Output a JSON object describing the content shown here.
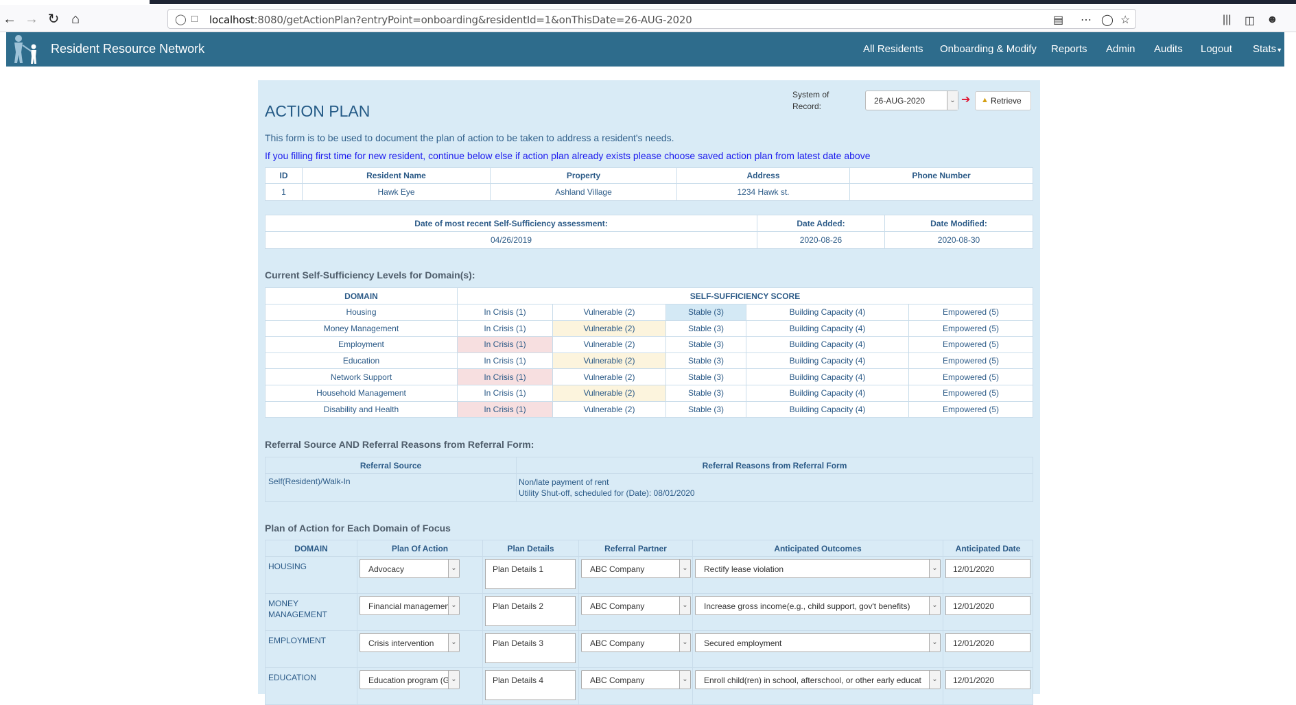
{
  "browser": {
    "url_host": "localhost",
    "url_rest": ":8080/getActionPlan?entryPoint=onboarding&residentId=1&onThisDate=26-AUG-2020"
  },
  "app": {
    "brand": "Resident Resource Network",
    "menu": [
      "All Residents",
      "Onboarding & Modify",
      "Reports",
      "Admin",
      "Audits",
      "Logout",
      "Stats"
    ]
  },
  "header": {
    "title": "ACTION PLAN",
    "system_of_record": "System of Record:",
    "date_value": "26-AUG-2020",
    "retrieve_label": "Retrieve",
    "desc1": "This form is to be used to document the plan of action to be taken to address a resident's needs.",
    "desc2": "If you filling first time for new resident, continue below else if action plan already exists please choose saved action plan from latest date above"
  },
  "resident": {
    "headers": [
      "ID",
      "Resident Name",
      "Property",
      "Address",
      "Phone Number"
    ],
    "row": [
      "1",
      "Hawk Eye",
      "Ashland Village",
      "1234 Hawk st.",
      ""
    ]
  },
  "dates": {
    "headers": [
      "Date of most recent Self-Sufficiency assessment:",
      "Date Added:",
      "Date Modified:"
    ],
    "row": [
      "04/26/2019",
      "2020-08-26",
      "2020-08-30"
    ]
  },
  "levels": {
    "section_title": "Current Self-Sufficiency Levels for Domain(s):",
    "header_domain": "DOMAIN",
    "header_score": "SELF-SUFFICIENCY SCORE",
    "score_labels": [
      "In Crisis (1)",
      "Vulnerable (2)",
      "Stable (3)",
      "Building Capacity (4)",
      "Empowered (5)"
    ],
    "rows": [
      {
        "domain": "Housing",
        "highlight": 3
      },
      {
        "domain": "Money Management",
        "highlight": 2
      },
      {
        "domain": "Employment",
        "highlight": 1
      },
      {
        "domain": "Education",
        "highlight": 2
      },
      {
        "domain": "Network Support",
        "highlight": 1
      },
      {
        "domain": "Household Management",
        "highlight": 2
      },
      {
        "domain": "Disability and Health",
        "highlight": 1
      }
    ]
  },
  "referral": {
    "section_title": "Referral Source AND Referral Reasons from Referral Form:",
    "headers": [
      "Referral Source",
      "Referral Reasons from Referral Form"
    ],
    "source": "Self(Resident)/Walk-In",
    "reason1": "Non/late payment of rent",
    "reason2": "Utility Shut-off, scheduled for (Date): 08/01/2020"
  },
  "plan": {
    "section_title": "Plan of Action for Each Domain of Focus",
    "headers": [
      "DOMAIN",
      "Plan Of Action",
      "Plan Details",
      "Referral Partner",
      "Anticipated Outcomes",
      "Anticipated Date"
    ],
    "rows": [
      {
        "domain": "HOUSING",
        "action": "Advocacy",
        "details": "Plan Details 1",
        "partner": "ABC Company",
        "outcome": "Rectify lease violation",
        "date": "12/01/2020"
      },
      {
        "domain": "MONEY MANAGEMENT",
        "action": "Financial management/lit",
        "details": "Plan Details 2",
        "partner": "ABC Company",
        "outcome": "Increase gross income(e.g., child support, gov't benefits)",
        "date": "12/01/2020"
      },
      {
        "domain": "EMPLOYMENT",
        "action": "Crisis intervention",
        "details": "Plan Details 3",
        "partner": "ABC Company",
        "outcome": "Secured employment",
        "date": "12/01/2020"
      },
      {
        "domain": "EDUCATION",
        "action": "Education program (GED,",
        "details": "Plan Details 4",
        "partner": "ABC Company",
        "outcome": "Enroll child(ren) in school, afterschool, or other early educat",
        "date": "12/01/2020"
      }
    ]
  },
  "colors": {
    "navbar": "#2e6c8c",
    "panel": "#d9ebf6",
    "crisis": "#f7dfe0",
    "vulnerable": "#fcf4dd",
    "stable": "#d4e9f5"
  }
}
